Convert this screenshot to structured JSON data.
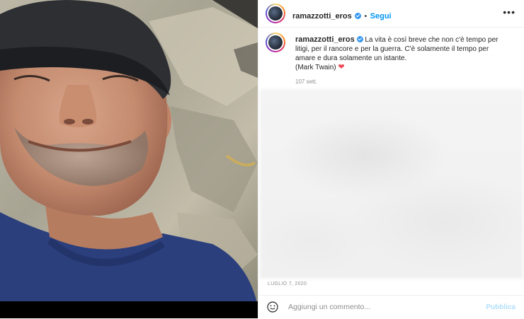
{
  "post": {
    "username": "ramazzotti_eros",
    "verified": true,
    "separator": "•",
    "follow_label": "Segui",
    "more_icon": "ellipsis-icon",
    "caption": {
      "username": "ramazzotti_eros",
      "text": "La vita è così breve che non c'è tempo per litigi, per il rancore e per la guerra. C'è solamente il tempo per amare e dura solamente un istante.\n(Mark Twain)",
      "heart": "❤"
    },
    "time_ago": "107 sett.",
    "date": "LUGLIO 7, 2020",
    "comment_placeholder": "Aggiungi un commento...",
    "publish_label": "Pubblica"
  },
  "colors": {
    "accent": "#0095f6",
    "verified": "#3897f0",
    "heart": "#ed4956",
    "publish_disabled": "#b2dffc",
    "muted_text": "#8e8e8e"
  }
}
